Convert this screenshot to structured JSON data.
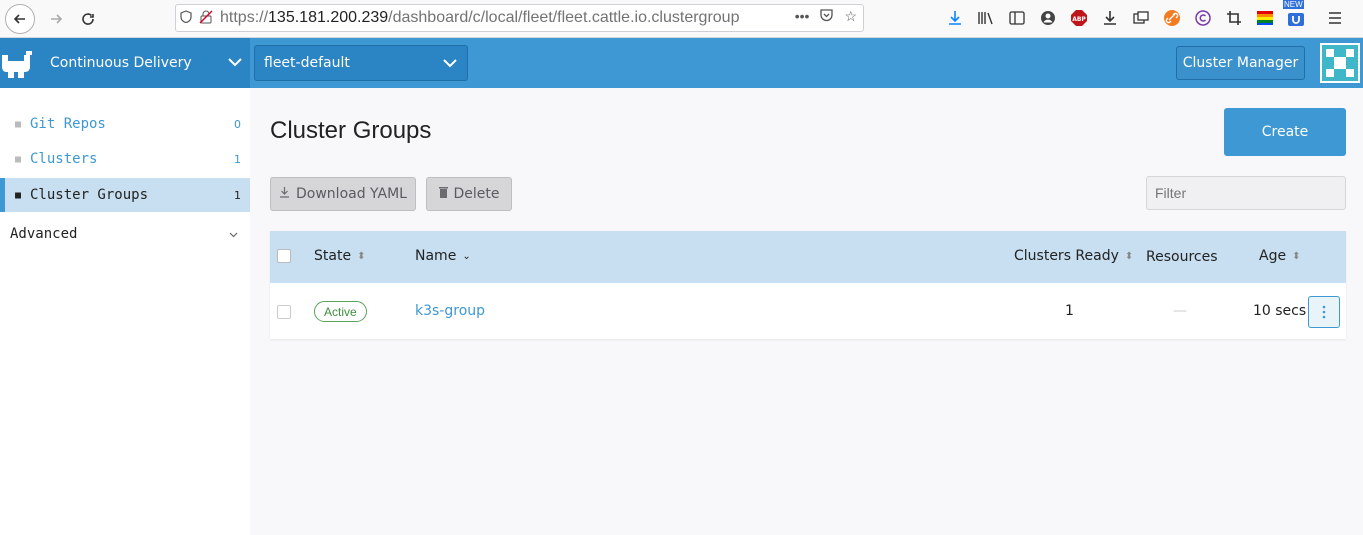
{
  "browser": {
    "url_prefix": "https://",
    "url_host": "135.181.200.239",
    "url_path": "/dashboard/c/local/fleet/fleet.cattle.io.clustergroup",
    "new_badge": "NEW"
  },
  "header": {
    "product_name": "Continuous Delivery",
    "workspace": "fleet-default",
    "cluster_manager_label": "Cluster Manager"
  },
  "sidebar": {
    "items": [
      {
        "label": "Git Repos",
        "count": "0"
      },
      {
        "label": "Clusters",
        "count": "1"
      },
      {
        "label": "Cluster Groups",
        "count": "1"
      }
    ],
    "group_label": "Advanced"
  },
  "main": {
    "title": "Cluster Groups",
    "create_label": "Create",
    "download_label": "Download YAML",
    "delete_label": "Delete",
    "filter_placeholder": "Filter"
  },
  "table": {
    "columns": [
      "State",
      "Name",
      "Clusters Ready",
      "Resources",
      "Age"
    ],
    "rows": [
      {
        "state": "Active",
        "name": "k3s-group",
        "clusters_ready": "1",
        "resources": "—",
        "age": "10 secs"
      }
    ]
  },
  "colors": {
    "accent": "#3d98d3",
    "header_bg": "#3d98d3",
    "active_row": "#c7dff1",
    "status_active": "#3e8e3e"
  }
}
